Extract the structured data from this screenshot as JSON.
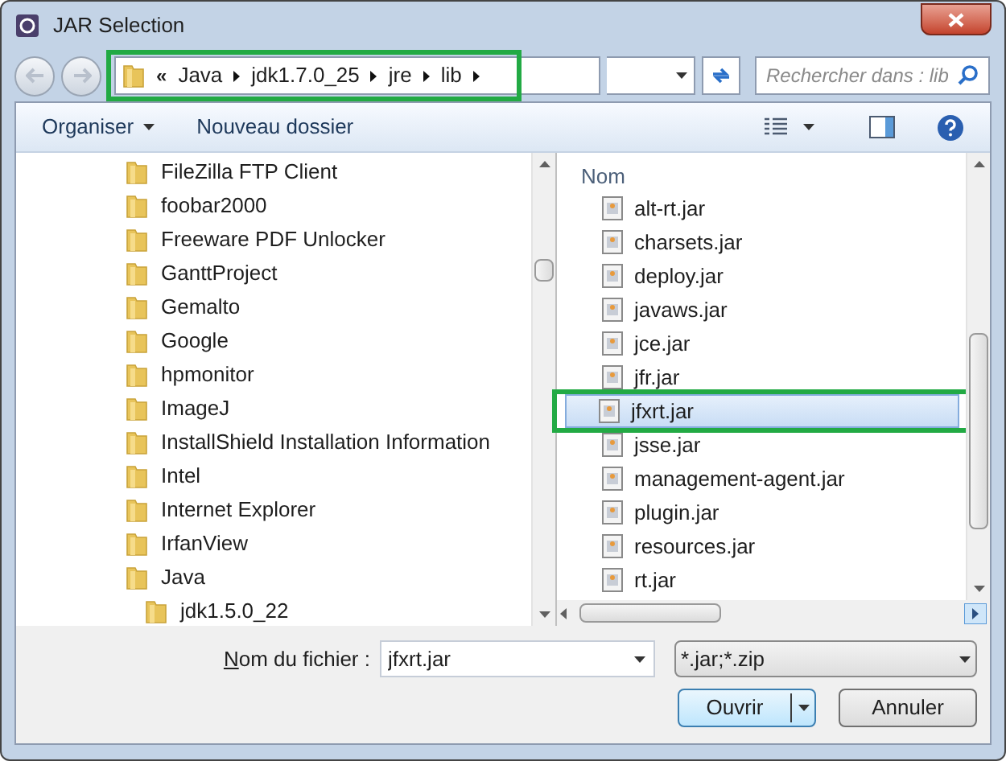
{
  "window": {
    "title": "JAR Selection"
  },
  "address": {
    "overflow": "«",
    "crumbs": [
      "Java",
      "jdk1.7.0_25",
      "jre",
      "lib"
    ],
    "search_placeholder": "Rechercher dans : lib"
  },
  "toolbar": {
    "organize": "Organiser",
    "new_folder": "Nouveau dossier"
  },
  "tree": [
    {
      "label": "FileZilla FTP Client"
    },
    {
      "label": "foobar2000"
    },
    {
      "label": "Freeware PDF Unlocker"
    },
    {
      "label": "GanttProject"
    },
    {
      "label": "Gemalto"
    },
    {
      "label": "Google"
    },
    {
      "label": "hpmonitor"
    },
    {
      "label": "ImageJ"
    },
    {
      "label": "InstallShield Installation Information"
    },
    {
      "label": "Intel"
    },
    {
      "label": "Internet Explorer"
    },
    {
      "label": "IrfanView"
    },
    {
      "label": "Java",
      "children": [
        {
          "label": "jdk1.5.0_22"
        }
      ]
    }
  ],
  "file_list": {
    "column": "Nom",
    "files": [
      {
        "name": "alt-rt.jar",
        "selected": false
      },
      {
        "name": "charsets.jar",
        "selected": false
      },
      {
        "name": "deploy.jar",
        "selected": false
      },
      {
        "name": "javaws.jar",
        "selected": false
      },
      {
        "name": "jce.jar",
        "selected": false
      },
      {
        "name": "jfr.jar",
        "selected": false
      },
      {
        "name": "jfxrt.jar",
        "selected": true
      },
      {
        "name": "jsse.jar",
        "selected": false
      },
      {
        "name": "management-agent.jar",
        "selected": false
      },
      {
        "name": "plugin.jar",
        "selected": false
      },
      {
        "name": "resources.jar",
        "selected": false
      },
      {
        "name": "rt.jar",
        "selected": false
      }
    ]
  },
  "footer": {
    "filename_label": "Nom du fichier :",
    "filename": "jfxrt.jar",
    "filter": "*.jar;*.zip",
    "open": "Ouvrir",
    "cancel": "Annuler"
  }
}
